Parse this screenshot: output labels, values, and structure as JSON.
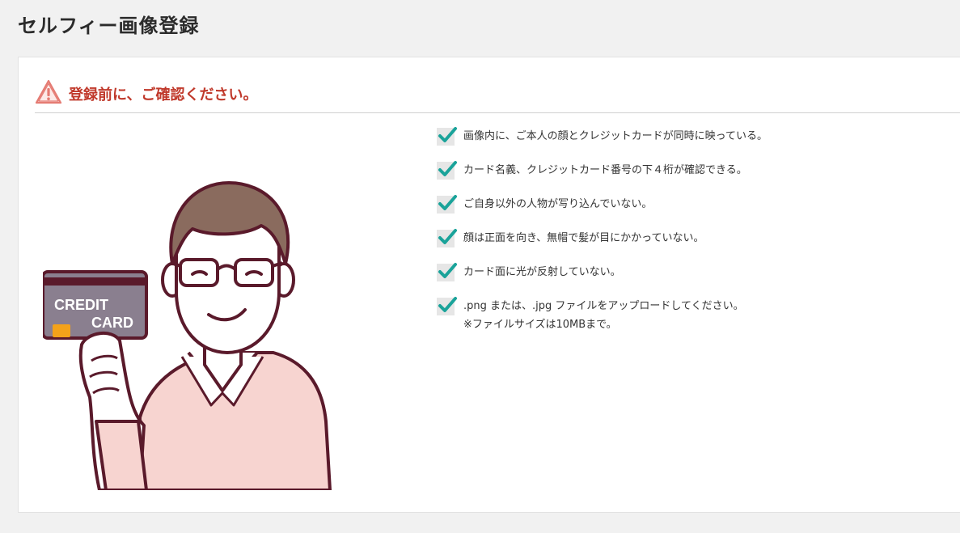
{
  "page": {
    "title": "セルフィー画像登録"
  },
  "notice": {
    "title": "登録前に、ご確認ください。",
    "icon": "warning-icon"
  },
  "illustration": {
    "card_line1": "CREDIT",
    "card_line2": "CARD"
  },
  "checklist": {
    "items": [
      {
        "text": "画像内に、ご本人の顔とクレジットカードが同時に映っている。"
      },
      {
        "text": "カード名義、クレジットカード番号の下４桁が確認できる。"
      },
      {
        "text": "ご自身以外の人物が写り込んでいない。"
      },
      {
        "text": "顔は正面を向き、無帽で髪が目にかかっていない。"
      },
      {
        "text": "カード面に光が反射していない。"
      },
      {
        "text": ".png または、.jpg ファイルをアップロードしてください。",
        "note": "※ファイルサイズは10MBまで。"
      }
    ]
  },
  "colors": {
    "accent_red": "#c0392b",
    "check_teal": "#1aa39a",
    "sweater": "#f7d4d0",
    "outline": "#5a1a2b",
    "hair": "#8a6b5e",
    "card": "#8a7f8f",
    "card_chip": "#f3a21a"
  }
}
